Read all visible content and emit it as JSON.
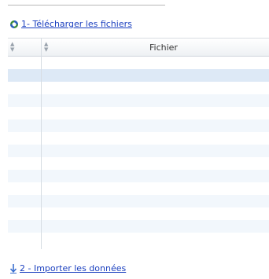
{
  "step1": {
    "label": "1- Télécharger les fichiers",
    "icon": "refresh-icon"
  },
  "grid": {
    "columns": [
      {
        "key": "index",
        "label": ""
      },
      {
        "key": "file",
        "label": "Fichier"
      }
    ],
    "sort_icon": "sort-icon",
    "row_count": 15,
    "selected_row": 1
  },
  "step2": {
    "label": "2 - Importer les données",
    "icon": "download-arrow-icon"
  },
  "colors": {
    "link": "#1a3fbf",
    "row_alt": "#f2f7fc",
    "row_selected": "#dde9f6"
  }
}
